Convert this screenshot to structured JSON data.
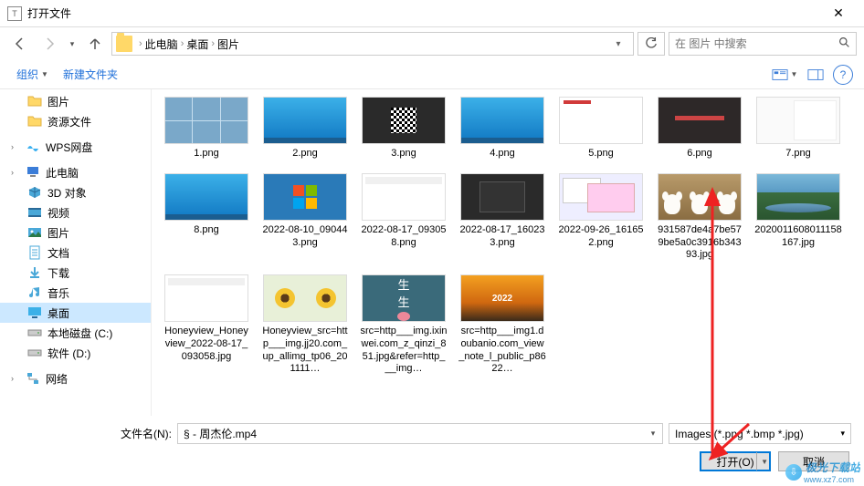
{
  "title": "打开文件",
  "breadcrumb": {
    "items": [
      "此电脑",
      "桌面",
      "图片"
    ]
  },
  "search": {
    "placeholder": "在 图片 中搜索"
  },
  "toolbar": {
    "organize": "组织",
    "newfolder": "新建文件夹"
  },
  "sidebar": {
    "items": [
      {
        "label": "图片",
        "icon": "folder",
        "level": 2
      },
      {
        "label": "资源文件",
        "icon": "folder",
        "level": 2
      },
      {
        "label": "WPS网盘",
        "icon": "wps",
        "level": 1,
        "expandable": true
      },
      {
        "label": "此电脑",
        "icon": "pc",
        "level": 1,
        "expandable": true
      },
      {
        "label": "3D 对象",
        "icon": "3d",
        "level": 2
      },
      {
        "label": "视频",
        "icon": "video",
        "level": 2
      },
      {
        "label": "图片",
        "icon": "pictures",
        "level": 2
      },
      {
        "label": "文档",
        "icon": "docs",
        "level": 2
      },
      {
        "label": "下载",
        "icon": "downloads",
        "level": 2
      },
      {
        "label": "音乐",
        "icon": "music",
        "level": 2
      },
      {
        "label": "桌面",
        "icon": "desktop",
        "level": 2,
        "selected": true
      },
      {
        "label": "本地磁盘 (C:)",
        "icon": "disk",
        "level": 2
      },
      {
        "label": "软件 (D:)",
        "icon": "disk",
        "level": 2
      },
      {
        "label": "网络",
        "icon": "network",
        "level": 1,
        "expandable": true
      }
    ]
  },
  "files": [
    {
      "name": "1.png",
      "thumb": "collage"
    },
    {
      "name": "2.png",
      "thumb": "desktop"
    },
    {
      "name": "3.png",
      "thumb": "qr"
    },
    {
      "name": "4.png",
      "thumb": "desktop"
    },
    {
      "name": "5.png",
      "thumb": "panel"
    },
    {
      "name": "6.png",
      "thumb": "dark"
    },
    {
      "name": "7.png",
      "thumb": "lightpanel"
    },
    {
      "name": "8.png",
      "thumb": "desktop"
    },
    {
      "name": "2022-08-10_090443.png",
      "thumb": "winlogo"
    },
    {
      "name": "2022-08-17_093058.png",
      "thumb": "white"
    },
    {
      "name": "2022-08-17_160233.png",
      "thumb": "screenshot2"
    },
    {
      "name": "2022-09-26_161652.png",
      "thumb": "multiwin"
    },
    {
      "name": "931587de4a7be579be5a0c3916b34393.jpg",
      "thumb": "dogs"
    },
    {
      "name": "2020011608011158167.jpg",
      "thumb": "landscape"
    },
    {
      "name": "Honeyview_Honeyview_2022-08-17_093058.jpg",
      "thumb": "white"
    },
    {
      "name": "Honeyview_src=http___img.jj20.com_up_allimg_tp06_201111…",
      "thumb": "sunflower"
    },
    {
      "name": "src=http___img.ixinwei.com_z_qinzi_851.jpg&refer=http___img…",
      "thumb": "text"
    },
    {
      "name": "src=http___img1.doubanio.com_view_note_l_public_p8622…",
      "thumb": "2022"
    }
  ],
  "filename": {
    "label": "文件名(N):",
    "value": "§ - 周杰伦.mp4"
  },
  "filter": {
    "label": "Images (*.png *.bmp *.jpg)"
  },
  "buttons": {
    "open": "打开(O)",
    "cancel": "取消"
  },
  "watermark": {
    "text": "极光下载站",
    "sub": "www.xz7.com"
  }
}
